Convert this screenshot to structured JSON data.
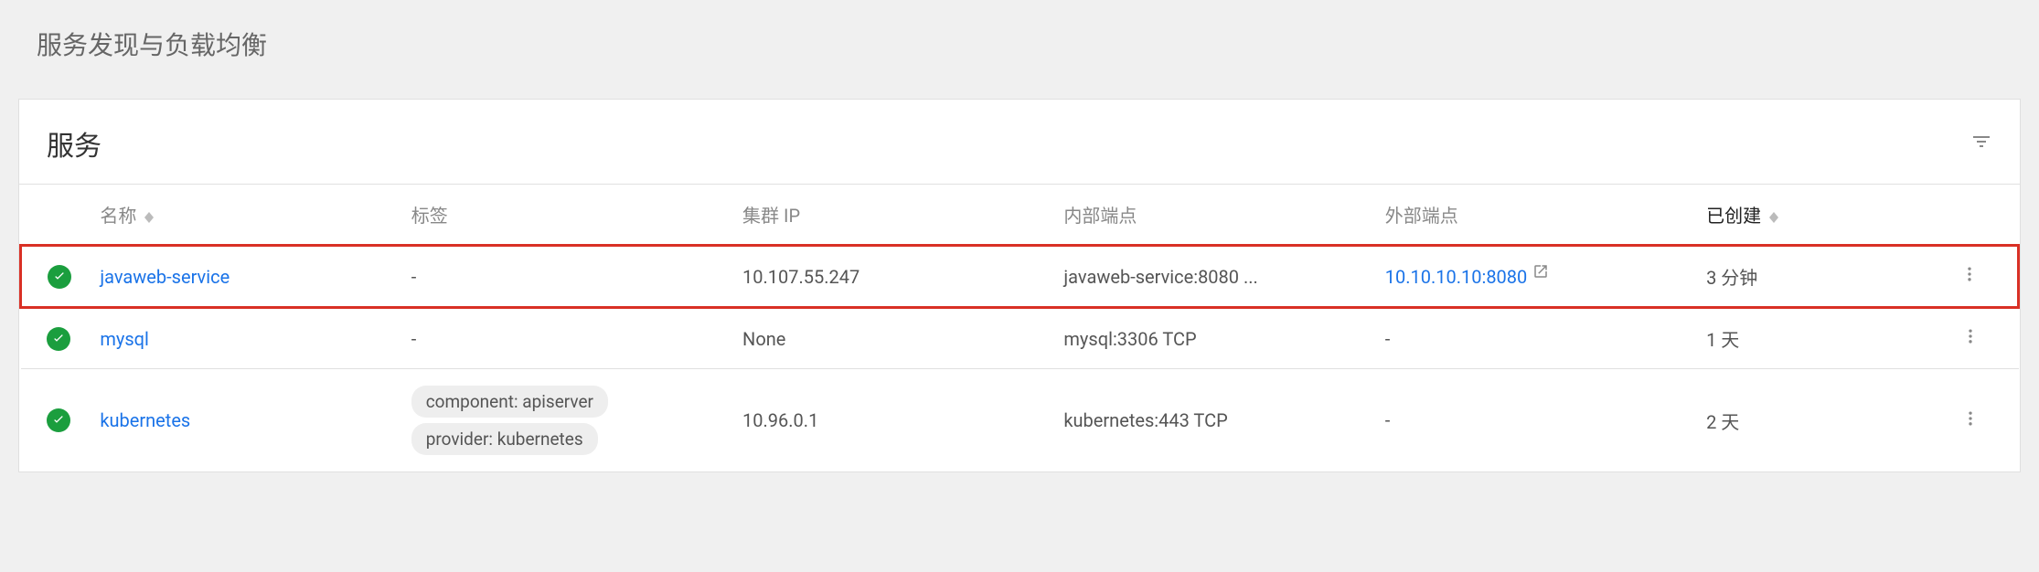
{
  "page": {
    "title": "服务发现与负载均衡"
  },
  "card": {
    "title": "服务"
  },
  "columns": {
    "name": "名称",
    "labels": "标签",
    "cluster_ip": "集群 IP",
    "internal": "内部端点",
    "external": "外部端点",
    "created": "已创建"
  },
  "rows": [
    {
      "highlighted": true,
      "name": "javaweb-service",
      "labels": "-",
      "has_labels": false,
      "cluster_ip": "10.107.55.247",
      "internal": "javaweb-service:8080 ...",
      "external": "10.10.10.10:8080",
      "has_external_link": true,
      "created": "3 分钟"
    },
    {
      "highlighted": false,
      "name": "mysql",
      "labels": "-",
      "has_labels": false,
      "cluster_ip": "None",
      "internal": "mysql:3306 TCP",
      "external": "-",
      "has_external_link": false,
      "created": "1 天"
    },
    {
      "highlighted": false,
      "name": "kubernetes",
      "has_labels": true,
      "label_list": [
        "component: apiserver",
        "provider: kubernetes"
      ],
      "cluster_ip": "10.96.0.1",
      "internal": "kubernetes:443 TCP",
      "external": "-",
      "has_external_link": false,
      "created": "2 天"
    }
  ]
}
